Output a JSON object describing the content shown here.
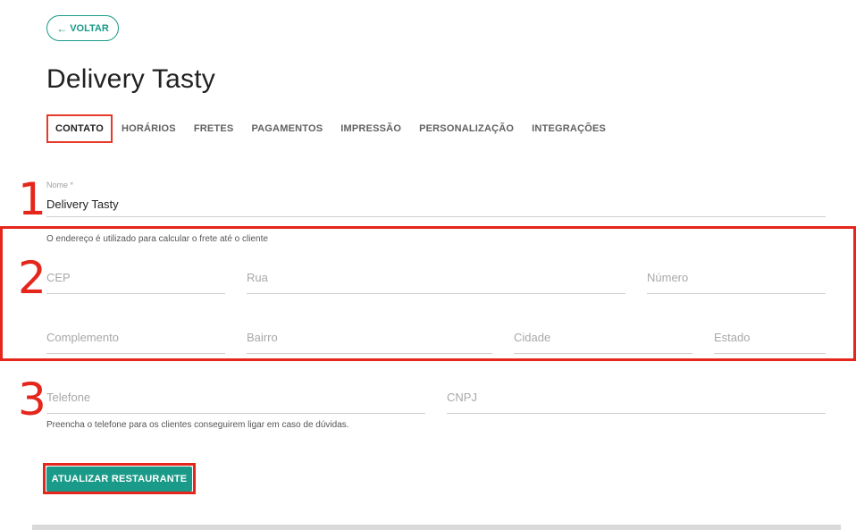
{
  "back_button": {
    "icon": "arrow-left-icon",
    "label": "VOLTAR"
  },
  "page_title": "Delivery Tasty",
  "tabs": [
    {
      "label": "CONTATO",
      "active": true
    },
    {
      "label": "HORÁRIOS"
    },
    {
      "label": "FRETES"
    },
    {
      "label": "PAGAMENTOS"
    },
    {
      "label": "IMPRESSÃO"
    },
    {
      "label": "PERSONALIZAÇÃO"
    },
    {
      "label": "INTEGRAÇÕES"
    }
  ],
  "annotations": {
    "n1": "1",
    "n2": "2",
    "n3": "3"
  },
  "name_field": {
    "label": "Nome *",
    "value": "Delivery Tasty"
  },
  "address_hint": "O endereço é utilizado para calcular o frete até o cliente",
  "address_fields": {
    "cep": "CEP",
    "rua": "Rua",
    "numero": "Número",
    "complemento": "Complemento",
    "bairro": "Bairro",
    "cidade": "Cidade",
    "estado": "Estado"
  },
  "contact_fields": {
    "telefone": "Telefone",
    "cnpj": "CNPJ"
  },
  "phone_hint": "Preencha o telefone para os clientes conseguirem ligar em caso de dúvidas.",
  "submit_button": "ATUALIZAR RESTAURANTE",
  "colors": {
    "accent": "#1a9a88",
    "annotation": "#e5261c"
  }
}
